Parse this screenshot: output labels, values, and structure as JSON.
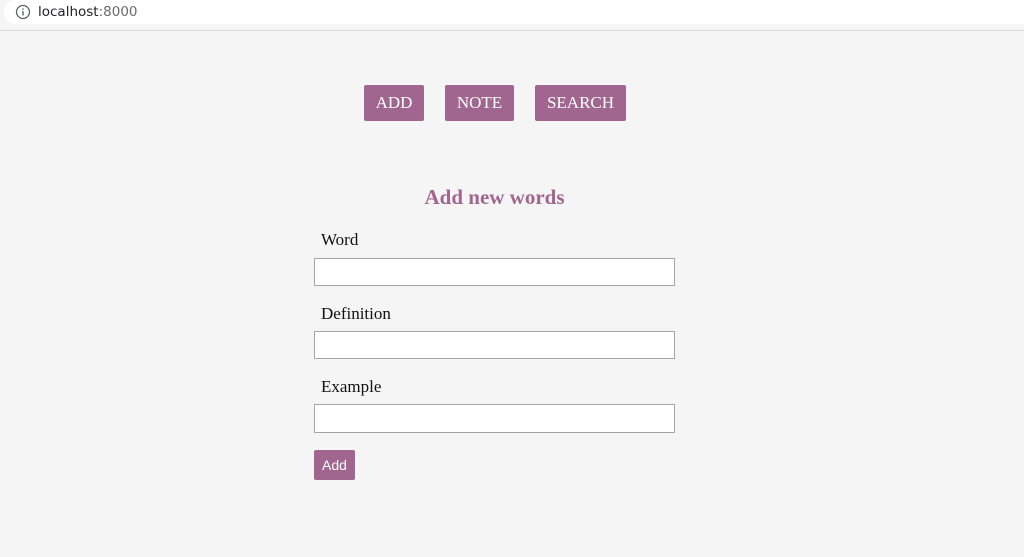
{
  "browser": {
    "url_host": "localhost",
    "url_port": ":8000",
    "info_icon": "info-icon"
  },
  "nav": {
    "add_label": "ADD",
    "note_label": "NOTE",
    "search_label": "SEARCH"
  },
  "form": {
    "title": "Add new words",
    "fields": [
      {
        "label": "Word",
        "value": "",
        "placeholder": ""
      },
      {
        "label": "Definition",
        "value": "",
        "placeholder": ""
      },
      {
        "label": "Example",
        "value": "",
        "placeholder": ""
      }
    ],
    "submit_label": "Add"
  },
  "colors": {
    "accent": "#a06690",
    "background": "#f5f5f5"
  }
}
